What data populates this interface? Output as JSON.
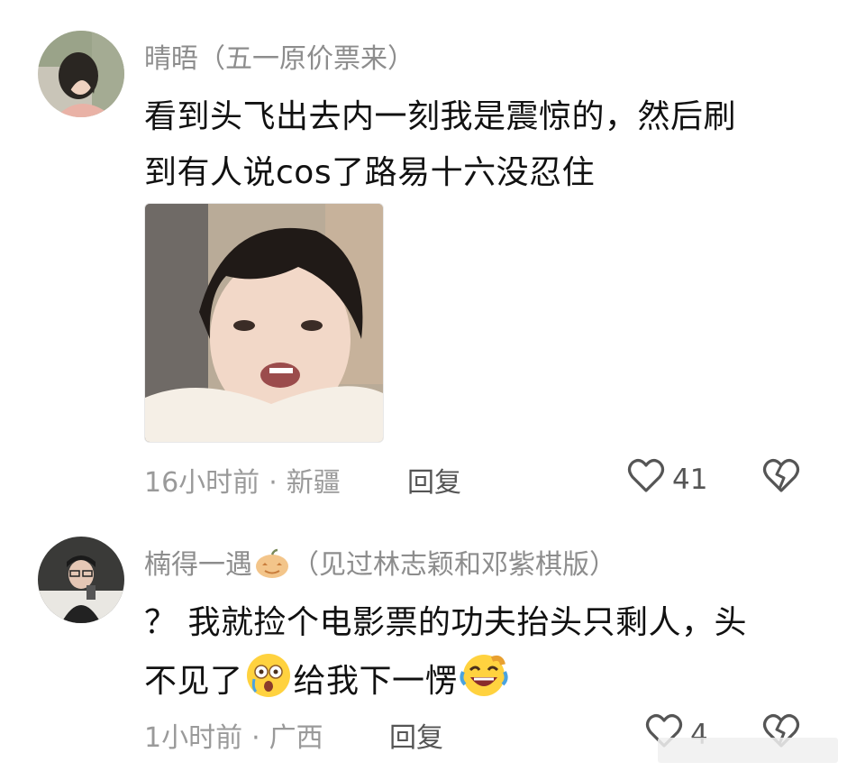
{
  "comments": [
    {
      "username": "晴晤",
      "badge": "（五一原价票来）",
      "text_lines": [
        "看到头飞出去内一刻我是震惊的，然后刷",
        "到有人说cos了路易十六没忍住"
      ],
      "time": "16小时前",
      "location": "新疆",
      "separator": "·",
      "reply_label": "回复",
      "likes": "41"
    },
    {
      "username": "楠得一遇",
      "badge": "（见过林志颖和邓紫棋版）",
      "text_lines": [
        "？ 我就捡个电影票的功夫抬头只剩人，头",
        "不见了",
        "给我下一愣"
      ],
      "time": "1小时前",
      "location": "广西",
      "separator": "·",
      "reply_label": "回复",
      "likes": "4"
    }
  ],
  "icons": {
    "like": "heart-outline-icon",
    "dislike": "broken-heart-icon",
    "pumpkin": "pumpkin-badge-icon",
    "emoji_shocked": "shocked-face-emoji",
    "emoji_laugh": "rofl-face-emoji"
  },
  "colors": {
    "username": "#8d8d8d",
    "text": "#111111",
    "meta": "#9a9a9a"
  }
}
